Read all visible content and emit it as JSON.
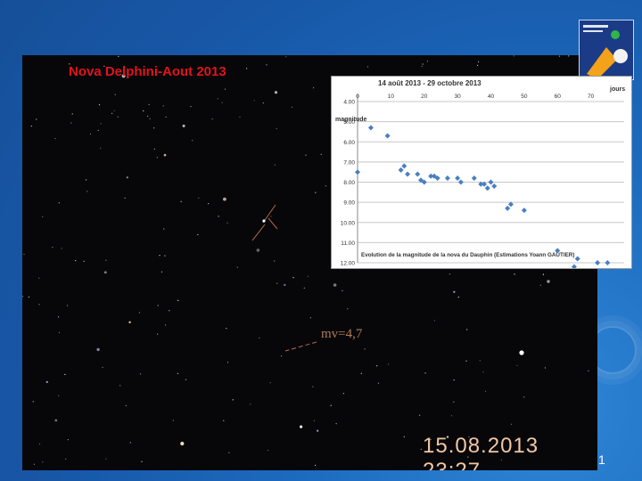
{
  "title": "Nova Delphini-Aout 2013",
  "annotation": "mv=4,7",
  "timestamp": "15.08.2013  23:27",
  "slide_number": "1",
  "logo_icon": "society-logo-icon",
  "chart_data": {
    "type": "scatter",
    "title": "14 août 2013 - 29 octobre 2013",
    "xlabel": "jours",
    "ylabel": "magnitude",
    "caption": "Evolution de la magnitude de la nova du Dauphin (Estimations Yoann GAUTIER)",
    "x_ticks": [
      "0",
      "10",
      "20",
      "30",
      "40",
      "50",
      "60",
      "70"
    ],
    "y_ticks": [
      "4.00",
      "5.00",
      "6.00",
      "7.00",
      "8.00",
      "9.00",
      "10.00",
      "11.00",
      "12.00"
    ],
    "xlim": [
      0,
      80
    ],
    "ylim": [
      4,
      12
    ],
    "y_inverted": true,
    "grid": true,
    "color": "#4a7fc1",
    "points": [
      {
        "x": 0,
        "y": 7.5
      },
      {
        "x": 4,
        "y": 5.3
      },
      {
        "x": 9,
        "y": 5.7
      },
      {
        "x": 13,
        "y": 7.4
      },
      {
        "x": 14,
        "y": 7.2
      },
      {
        "x": 15,
        "y": 7.6
      },
      {
        "x": 18,
        "y": 7.6
      },
      {
        "x": 19,
        "y": 7.9
      },
      {
        "x": 20,
        "y": 8.0
      },
      {
        "x": 22,
        "y": 7.7
      },
      {
        "x": 23,
        "y": 7.7
      },
      {
        "x": 24,
        "y": 7.8
      },
      {
        "x": 27,
        "y": 7.8
      },
      {
        "x": 30,
        "y": 7.8
      },
      {
        "x": 31,
        "y": 8.0
      },
      {
        "x": 35,
        "y": 7.8
      },
      {
        "x": 37,
        "y": 8.1
      },
      {
        "x": 38,
        "y": 8.1
      },
      {
        "x": 39,
        "y": 8.3
      },
      {
        "x": 40,
        "y": 8.0
      },
      {
        "x": 41,
        "y": 8.2
      },
      {
        "x": 45,
        "y": 9.3
      },
      {
        "x": 46,
        "y": 9.1
      },
      {
        "x": 50,
        "y": 9.4
      },
      {
        "x": 60,
        "y": 11.4
      },
      {
        "x": 65,
        "y": 12.2
      },
      {
        "x": 66,
        "y": 11.8
      },
      {
        "x": 72,
        "y": 12.0
      },
      {
        "x": 75,
        "y": 12.0
      }
    ]
  }
}
